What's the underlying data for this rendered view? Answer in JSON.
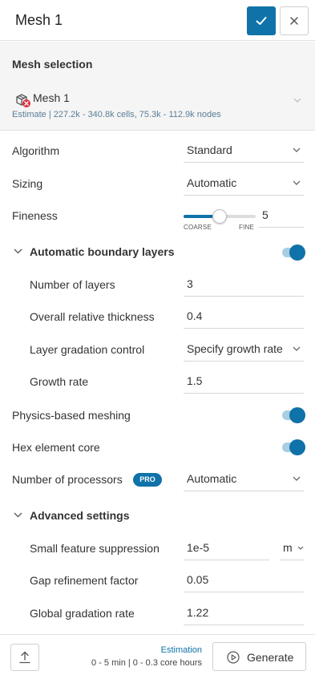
{
  "header": {
    "title": "Mesh 1"
  },
  "mesh_selection": {
    "heading": "Mesh selection",
    "mesh_name": "Mesh 1",
    "estimate": "Estimate | 227.2k - 340.8k cells, 75.3k - 112.9k nodes"
  },
  "settings": {
    "algorithm": {
      "label": "Algorithm",
      "value": "Standard"
    },
    "sizing": {
      "label": "Sizing",
      "value": "Automatic"
    },
    "fineness": {
      "label": "Fineness",
      "value": "5",
      "min_label": "COARSE",
      "max_label": "FINE",
      "level_fraction": 0.5
    },
    "boundary_layers": {
      "label": "Automatic boundary layers",
      "enabled": true,
      "num_layers": {
        "label": "Number of layers",
        "value": "3"
      },
      "thickness": {
        "label": "Overall relative thickness",
        "value": "0.4"
      },
      "gradation": {
        "label": "Layer gradation control",
        "value": "Specify growth rate"
      },
      "growth_rate": {
        "label": "Growth rate",
        "value": "1.5"
      }
    },
    "physics_meshing": {
      "label": "Physics-based meshing",
      "enabled": true
    },
    "hex_core": {
      "label": "Hex element core",
      "enabled": true
    },
    "processors": {
      "label": "Number of processors",
      "badge": "PRO",
      "value": "Automatic"
    },
    "advanced": {
      "label": "Advanced settings",
      "small_feature": {
        "label": "Small feature suppression",
        "value": "1e-5",
        "unit": "m"
      },
      "gap_refinement": {
        "label": "Gap refinement factor",
        "value": "0.05"
      },
      "global_gradation": {
        "label": "Global gradation rate",
        "value": "1.22"
      }
    }
  },
  "footer": {
    "estimation_title": "Estimation",
    "estimation_value": "0 - 5 min | 0 - 0.3 core hours",
    "generate_label": "Generate"
  },
  "colors": {
    "accent": "#0f72a8",
    "toggle_track": "#a9cde2",
    "estimate_text": "#5a7e96"
  }
}
